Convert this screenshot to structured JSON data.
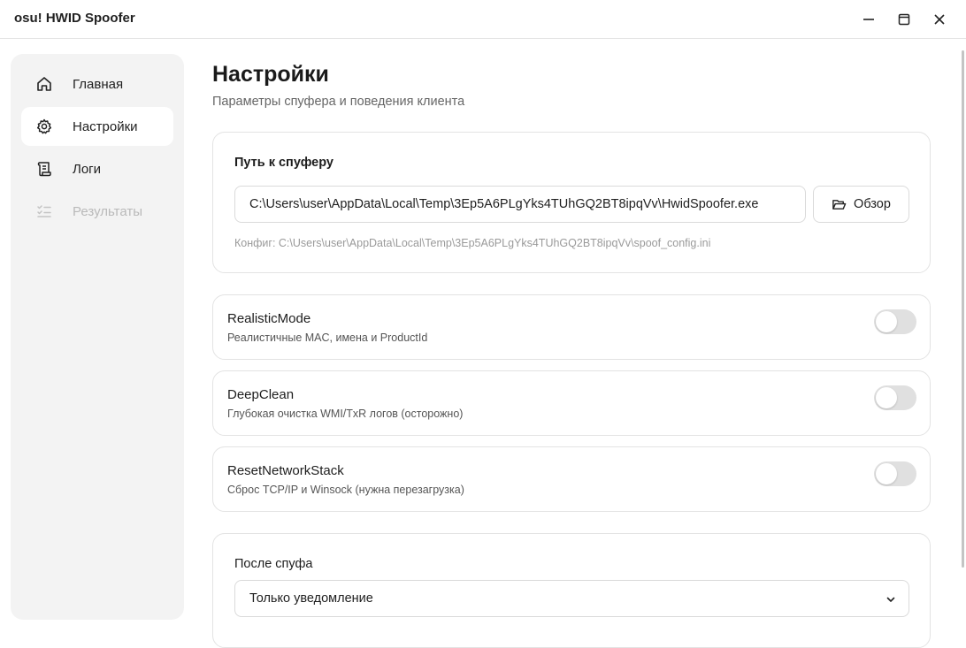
{
  "window": {
    "title": "osu! HWID Spoofer",
    "controls": {
      "minimize": "minimize-icon",
      "maximize": "maximize-icon",
      "close": "close-icon"
    }
  },
  "sidebar": {
    "items": [
      {
        "label": "Главная",
        "icon": "home-icon",
        "state": "normal"
      },
      {
        "label": "Настройки",
        "icon": "gear-icon",
        "state": "active"
      },
      {
        "label": "Логи",
        "icon": "scroll-icon",
        "state": "normal"
      },
      {
        "label": "Результаты",
        "icon": "checklist-icon",
        "state": "disabled"
      }
    ]
  },
  "page": {
    "title": "Настройки",
    "subtitle": "Параметры спуфера и поведения клиента"
  },
  "spoofer_path": {
    "heading": "Путь к спуферу",
    "value": "C:\\Users\\user\\AppData\\Local\\Temp\\3Ep5A6PLgYks4TUhGQ2BT8ipqVv\\HwidSpoofer.exe",
    "browse_label": "Обзор",
    "browse_icon": "folder-open-icon",
    "config_text": "Конфиг: C:\\Users\\user\\AppData\\Local\\Temp\\3Ep5A6PLgYks4TUhGQ2BT8ipqVv\\spoof_config.ini"
  },
  "toggles": [
    {
      "title": "RealisticMode",
      "description": "Реалистичные MAC, имена и ProductId",
      "enabled": false
    },
    {
      "title": "DeepClean",
      "description": "Глубокая очистка WMI/TxR логов (осторожно)",
      "enabled": false
    },
    {
      "title": "ResetNetworkStack",
      "description": "Сброс TCP/IP и Winsock (нужна перезагрузка)",
      "enabled": false
    }
  ],
  "after_spoof": {
    "heading": "После спуфа",
    "selected": "Только уведомление"
  },
  "colors": {
    "sidebar_bg": "#f3f3f3",
    "active_item_bg": "#ffffff",
    "toggle_off": "#e0e0e0",
    "border": "#e3e3e3"
  }
}
